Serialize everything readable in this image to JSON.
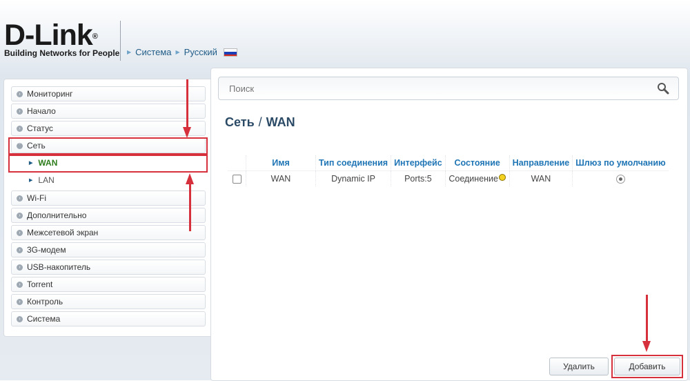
{
  "brand": {
    "name": "D-Link",
    "reg": "®",
    "tagline": "Building Networks for People"
  },
  "breadcrumbs": [
    {
      "label": "Система"
    },
    {
      "label": "Русский"
    }
  ],
  "sidebar": {
    "items": [
      {
        "label": "Мониторинг"
      },
      {
        "label": "Начало"
      },
      {
        "label": "Статус"
      },
      {
        "label": "Сеть",
        "expanded": true
      },
      {
        "label": "WAN",
        "sub": true,
        "active": true
      },
      {
        "label": "LAN",
        "sub": true
      },
      {
        "label": "Wi-Fi"
      },
      {
        "label": "Дополнительно"
      },
      {
        "label": "Межсетевой экран"
      },
      {
        "label": "3G-модем"
      },
      {
        "label": "USB-накопитель"
      },
      {
        "label": "Torrent"
      },
      {
        "label": "Контроль"
      },
      {
        "label": "Система"
      }
    ]
  },
  "search": {
    "placeholder": "Поиск"
  },
  "page": {
    "section": "Сеть",
    "sep": "/",
    "subsection": "WAN"
  },
  "table": {
    "headers": [
      "Имя",
      "Тип соединения",
      "Интерфейс",
      "Состояние",
      "Направление",
      "Шлюз по умолчанию"
    ],
    "rows": [
      {
        "name": "WAN",
        "type": "Dynamic IP",
        "iface": "Ports:5",
        "state": "Соединение",
        "state_color": "#f3d11f",
        "direction": "WAN",
        "default_gw": true
      }
    ]
  },
  "buttons": {
    "delete": "Удалить",
    "add": "Добавить"
  },
  "colors": {
    "highlight": "#d7303d",
    "accent": "#1f75b5",
    "active_text": "#2e7d1c"
  }
}
